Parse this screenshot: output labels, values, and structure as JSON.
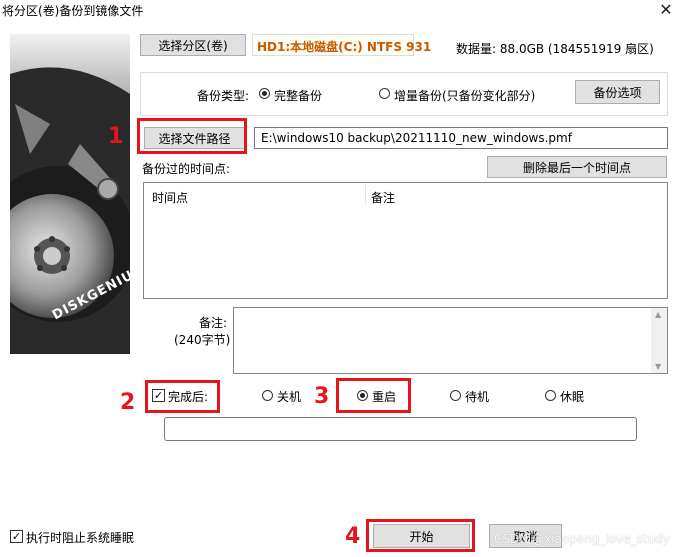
{
  "window": {
    "title": "将分区(卷)备份到镜像文件",
    "close_label": "✕"
  },
  "partition": {
    "select_button": "选择分区(卷)",
    "name": "HD1:本地磁盘(C:) NTFS 931",
    "data_size": "数据量: 88.0GB (184551919 扇区)"
  },
  "backup_type": {
    "label": "备份类型:",
    "options": [
      {
        "label": "完整备份",
        "selected": true
      },
      {
        "label": "增量备份(只备份变化部分)",
        "selected": false
      }
    ],
    "options_button": "备份选项"
  },
  "file_path": {
    "select_button": "选择文件路径",
    "value": "E:\\windows10 backup\\20211110_new_windows.pmf"
  },
  "timepoints": {
    "label": "备份过的时间点:",
    "delete_button": "删除最后一个时间点",
    "columns": [
      "时间点",
      "备注"
    ]
  },
  "remark": {
    "label": "备注:",
    "sublabel": "(240字节)",
    "value": ""
  },
  "after_complete": {
    "checkbox_label": "完成后:",
    "checked": true,
    "options": [
      {
        "label": "关机",
        "selected": false
      },
      {
        "label": "重启",
        "selected": true
      },
      {
        "label": "待机",
        "selected": false
      },
      {
        "label": "休眠",
        "selected": false
      }
    ],
    "command_value": ""
  },
  "footer": {
    "prevent_sleep_label": "执行时阻止系统睡眠",
    "prevent_sleep_checked": true,
    "start_button": "开始",
    "cancel_button": "取消"
  },
  "annotations": [
    "1",
    "2",
    "3",
    "4"
  ],
  "brand_text": "DISKGENIUS",
  "watermark": "CSDN @xiaopang_love_study",
  "colors": {
    "highlight": "#e8141c",
    "partition_text": "#c85a00"
  }
}
